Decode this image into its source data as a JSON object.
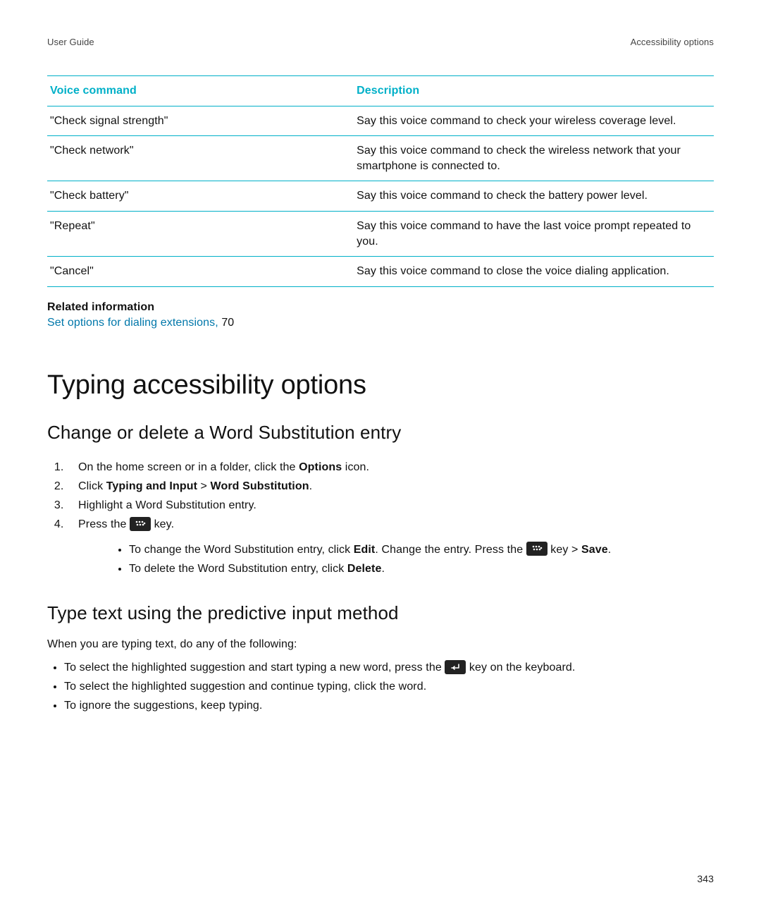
{
  "header": {
    "left": "User Guide",
    "right": "Accessibility options"
  },
  "table": {
    "head_cmd": "Voice command",
    "head_desc": "Description",
    "rows": [
      {
        "cmd": "\"Check signal strength\"",
        "desc": "Say this voice command to check your wireless coverage level."
      },
      {
        "cmd": "\"Check network\"",
        "desc": "Say this voice command to check the wireless network that your smartphone is connected to."
      },
      {
        "cmd": "\"Check battery\"",
        "desc": "Say this voice command to check the battery power level."
      },
      {
        "cmd": "\"Repeat\"",
        "desc": "Say this voice command to have the last voice prompt repeated to you."
      },
      {
        "cmd": "\"Cancel\"",
        "desc": "Say this voice command to close the voice dialing application."
      }
    ]
  },
  "related": {
    "heading": "Related information",
    "link_text": "Set options for dialing extensions, ",
    "link_page": "70"
  },
  "h1": "Typing accessibility options",
  "sectionA": {
    "title": "Change or delete a Word Substitution entry",
    "step1_a": "On the home screen or in a folder, click the ",
    "step1_b": "Options",
    "step1_c": " icon.",
    "step2_a": "Click ",
    "step2_b": "Typing and Input",
    "step2_c": " > ",
    "step2_d": "Word Substitution",
    "step2_e": ".",
    "step3": "Highlight a Word Substitution entry.",
    "step4_a": "Press the ",
    "step4_b": " key.",
    "sub1_a": "To change the Word Substitution entry, click ",
    "sub1_b": "Edit",
    "sub1_c": ". Change the entry. Press the ",
    "sub1_d": " key > ",
    "sub1_e": "Save",
    "sub1_f": ".",
    "sub2_a": "To delete the Word Substitution entry, click ",
    "sub2_b": "Delete",
    "sub2_c": "."
  },
  "sectionB": {
    "title": "Type text using the predictive input method",
    "intro": "When you are typing text, do any of the following:",
    "b1_a": "To select the highlighted suggestion and start typing a new word, press the ",
    "b1_b": " key on the keyboard.",
    "b2": "To select the highlighted suggestion and continue typing, click the word.",
    "b3": "To ignore the suggestions, keep typing."
  },
  "page_number": "343"
}
